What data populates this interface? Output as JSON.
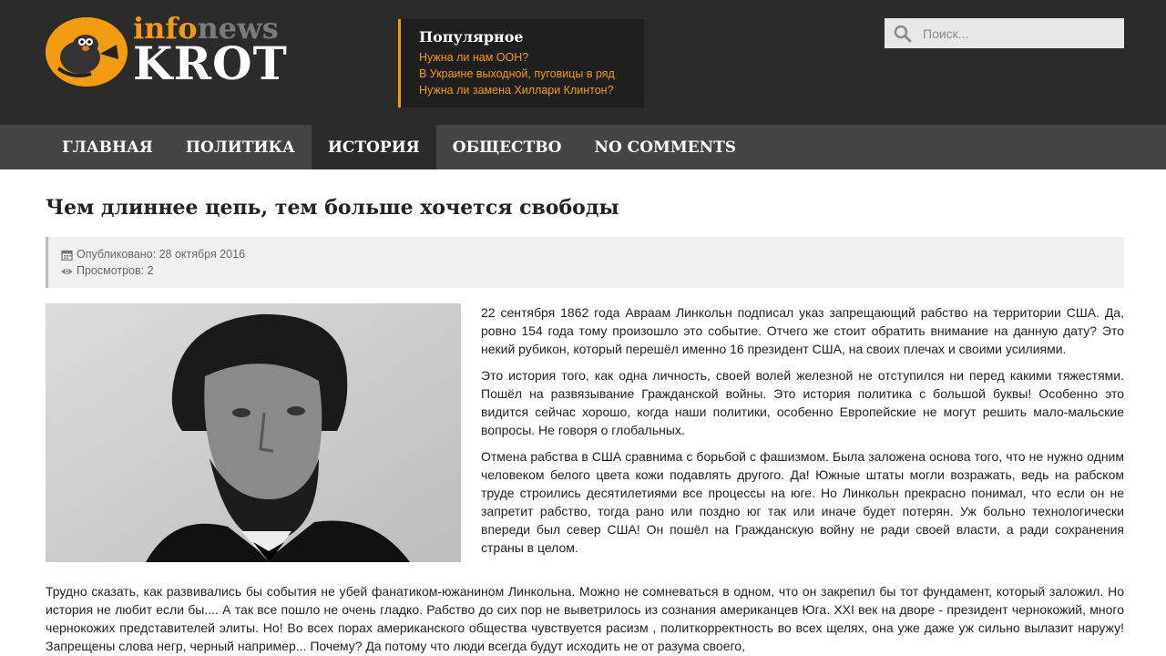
{
  "site": {
    "logo_top_a": "info",
    "logo_top_b": "news",
    "logo_bottom": "KROT"
  },
  "popular": {
    "title": "Популярное",
    "links": [
      "Нужна ли нам ООН?",
      "В Украине выходной, пуговицы в ряд",
      "Нужна ли замена Хиллари Клинтон?"
    ]
  },
  "search": {
    "placeholder": "Поиск..."
  },
  "nav": {
    "items": [
      "ГЛАВНАЯ",
      "ПОЛИТИКА",
      "ИСТОРИЯ",
      "ОБЩЕСТВО",
      "NO COMMENTS"
    ],
    "active": "ИСТОРИЯ"
  },
  "article": {
    "title": "Чем длиннее цепь, тем больше хочется свободы",
    "published": "Опубликовано: 28 октября 2016",
    "views": "Просмотров: 2",
    "paragraphs": [
      "22 сентября 1862 года Авраам Линкольн подписал указ запрещающий рабство на территории США. Да, ровно 154 года тому произошло это событие. Отчего же стоит обратить внимание на данную дату? Это некий рубикон, который перешёл именно 16 президент США, на своих плечах и своими усилиями.",
      "Это история того, как одна личность, своей волей железной не отступился ни перед какими тяжестями. Пошёл на развязывание Гражданской войны. Это история политика с большой буквы! Особенно это видится сейчас хорошо, когда наши политики, особенно Европейские не могут решить мало-мальские вопросы. Не говоря о глобальных.",
      "Отмена рабства в США сравнима с борьбой с фашизмом. Была заложена основа того, что не нужно одним человеком белого цвета кожи подавлять другого. Да! Южные штаты могли возражать, ведь на рабском труде строились десятилетиями все процессы на юге. Но Линкольн прекрасно понимал, что если он не запретит рабство, тогда рано или поздно юг так или иначе будет потерян. Уж больно технологически впереди был север США! Он пошёл на Гражданскую войну не ради своей власти, а ради сохранения страны в целом.",
      "Трудно сказать, как развивались бы события не убей фанатиком-южанином Линкольна. Можно не сомневаться в одном, что он закрепил бы тот фундамент, который заложил. Но история не любит если бы.... А так все пошло не очень гладко. Рабство до сих пор не выветрилось из сознания американцев Юга. XXI век на дворе - президент чернокожий, много чернокожих представителей элиты. Но! Во всех порах американского общества чувствуется расизм , политкорректность во всех щелях, она уже даже уж сильно вылазит наружу! Запрещены слова негр, черный например... Почему? Да потому что люди всегда будут исходить не от разума своего,"
    ]
  },
  "colors": {
    "accent": "#f39c12",
    "header_bg": "#2b2b2b",
    "nav_bg": "#444444"
  },
  "icons": {
    "search": "search-icon",
    "calendar": "calendar-icon",
    "eye": "eye-icon",
    "mascot": "mole-mascot-icon"
  }
}
